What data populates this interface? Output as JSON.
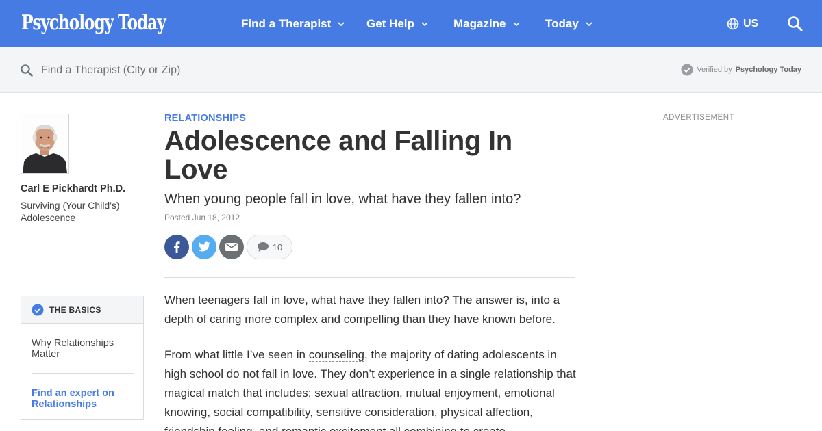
{
  "brand": {
    "logo_text": "Psychology Today",
    "accent": "#477be4"
  },
  "nav": {
    "items": [
      {
        "label": "Find a Therapist"
      },
      {
        "label": "Get Help"
      },
      {
        "label": "Magazine"
      },
      {
        "label": "Today"
      }
    ],
    "region": "US"
  },
  "search": {
    "placeholder": "Find a Therapist (City or Zip)",
    "verified_prefix": "Verified by",
    "verified_brand": "Psychology Today"
  },
  "author": {
    "name": "Carl E Pickhardt Ph.D.",
    "blog": "Surviving (Your Child's) Adolescence"
  },
  "basics": {
    "heading": "THE BASICS",
    "link": "Why Relationships Matter",
    "cta": "Find an expert on Relationships"
  },
  "article": {
    "category": "RELATIONSHIPS",
    "title": "Adolescence and Falling In Love",
    "subtitle": "When young people fall in love, what have they fallen into?",
    "posted": "Posted Jun 18, 2012",
    "comment_count": "10",
    "p1": "When teenagers fall in love, what have they fallen into? The answer is, into a depth of caring more complex and compelling than they have known before.",
    "p2": {
      "a": "From what little I’ve seen in ",
      "link1": "counseling",
      "b": ", the majority of dating adolescents in high school do not fall in love. They don’t experience in a single relationship that magical match that includes: sexual ",
      "link2": "attraction",
      "c": ", mutual enjoyment, emotional knowing, social compatibility, sensitive consideration, physical affection, friendship feeling, and romantic excitement all combining to create"
    }
  },
  "sidebar": {
    "ad_label": "ADVERTISEMENT"
  }
}
